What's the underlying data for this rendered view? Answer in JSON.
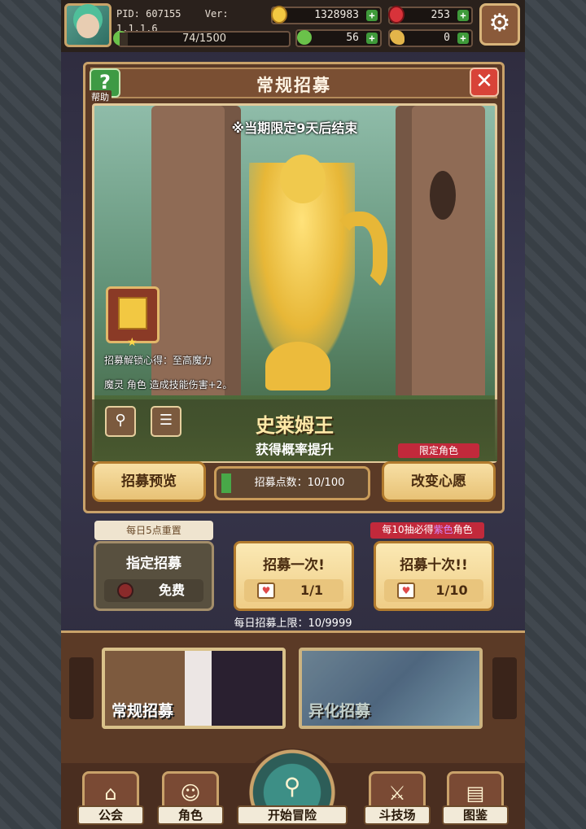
{
  "status": {
    "pid": "PID: 607155",
    "version": "Ver: 1.1.1.6",
    "gold": "1328983",
    "gems": "253",
    "exp": "74/1500",
    "exp_fraction": 0.049,
    "clover": "56",
    "horn": "0"
  },
  "icons": {
    "settings": "gear-icon",
    "help": "question-icon",
    "close": "close-icon"
  },
  "dialog": {
    "title": "常规招募",
    "help_label": "帮助",
    "limit_notice": "※当期限定9天后结束",
    "unlock_title": "招募解锁心得：至高魔力",
    "unlock_desc": "魔灵 角色 造成技能伤害+2。",
    "char_name": "史莱姆王",
    "rate_up": "获得概率提升",
    "preview_button": "招募预览",
    "points_label": "招募点数：10/100",
    "points_fraction": 0.1,
    "limited_tag": "限定角色",
    "change_wish_button": "改变心愿"
  },
  "recruit": {
    "reset_tag": "每日5点重置",
    "guarantee_prefix": "每10抽必得",
    "guarantee_color_word": "紫色",
    "guarantee_suffix": "角色",
    "designated_title": "指定招募",
    "designated_cost": "免费",
    "single_title": "招募一次!",
    "single_cost": "1/1",
    "ten_title": "招募十次!!",
    "ten_cost": "1/10",
    "daily_limit": "每日招募上限：10/9999"
  },
  "banners": {
    "normal": "常规招募",
    "special": "异化招募"
  },
  "nav": {
    "guild": "公会",
    "character": "角色",
    "adventure": "开始冒险",
    "arena": "斗技场",
    "codex": "图鉴"
  },
  "colors": {
    "accent_gold": "#e8c276",
    "purple_word": "#c46cff",
    "tag_red": "#c2293b"
  }
}
